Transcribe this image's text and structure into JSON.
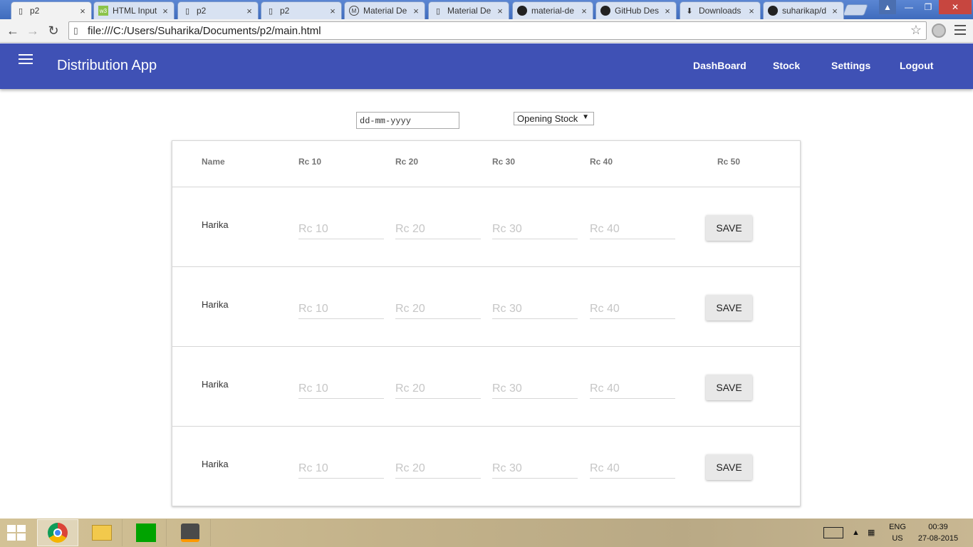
{
  "browser": {
    "tabs": [
      {
        "title": "p2",
        "icon": "page-icon",
        "active": true
      },
      {
        "title": "HTML Input",
        "icon": "w3-icon"
      },
      {
        "title": "p2",
        "icon": "page-icon"
      },
      {
        "title": "p2",
        "icon": "page-icon"
      },
      {
        "title": "Material De",
        "icon": "m-icon"
      },
      {
        "title": "Material De",
        "icon": "page-icon"
      },
      {
        "title": "material-de",
        "icon": "github-icon"
      },
      {
        "title": "GitHub Des",
        "icon": "github-icon"
      },
      {
        "title": "Downloads",
        "icon": "download-icon"
      },
      {
        "title": "suharikap/d",
        "icon": "github-icon"
      }
    ],
    "close_glyph": "×",
    "url": "file:///C:/Users/Suharika/Documents/p2/main.html"
  },
  "app": {
    "title": "Distribution App",
    "nav": [
      "DashBoard",
      "Stock",
      "Settings",
      "Logout"
    ],
    "accent": "#3f51b5"
  },
  "filters": {
    "date_value": "dd-mm-yyyy",
    "stock_type": "Opening Stock"
  },
  "table": {
    "headers": [
      "Name",
      "Rc 10",
      "Rc 20",
      "Rc 30",
      "Rc 40",
      "Rc 50"
    ],
    "placeholders": [
      "Rc 10",
      "Rc 20",
      "Rc 30",
      "Rc 40"
    ],
    "save_label": "SAVE",
    "rows": [
      {
        "name": "Harika"
      },
      {
        "name": "Harika"
      },
      {
        "name": "Harika"
      },
      {
        "name": "Harika"
      }
    ]
  },
  "taskbar": {
    "apps": [
      "chrome-icon",
      "file-explorer-icon",
      "store-icon",
      "sublime-text-icon"
    ],
    "lang": "ENG",
    "region": "US",
    "time": "00:39",
    "date": "27-08-2015"
  }
}
